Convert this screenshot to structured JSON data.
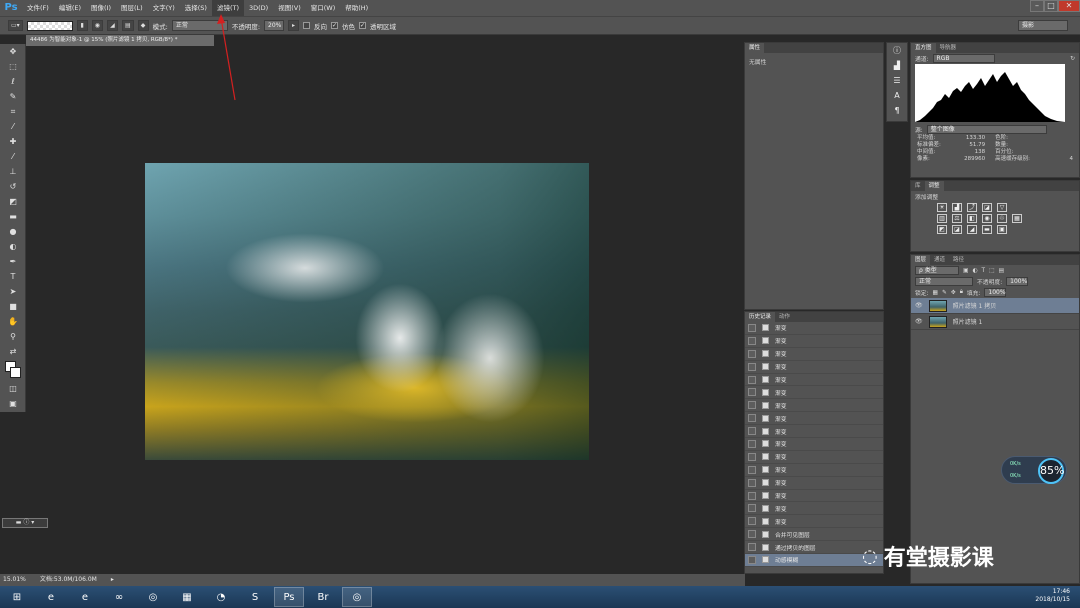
{
  "app": {
    "logo": "Ps"
  },
  "menubar": {
    "items": [
      "文件(F)",
      "编辑(E)",
      "图像(I)",
      "图层(L)",
      "文字(Y)",
      "选择(S)",
      "滤镜(T)",
      "3D(D)",
      "视图(V)",
      "窗口(W)",
      "帮助(H)"
    ],
    "active_index": 6
  },
  "options": {
    "mode_label": "模式:",
    "mode_value": "正常",
    "opacity_label": "不透明度:",
    "opacity_value": "20%",
    "reverse_label": "反向",
    "dither_label": "仿色",
    "transparency_label": "透明区域",
    "workspace": "摄影"
  },
  "document": {
    "tab_title": "44486 为智能对象-1 @ 15% (照片滤镜 1 拷贝, RGB/8*) *"
  },
  "status": {
    "zoom": "15.01%",
    "doc_size": "文档:53.0M/106.0M"
  },
  "properties": {
    "tab": "属性",
    "empty_text": "无属性"
  },
  "history": {
    "tabs": [
      "历史记录",
      "动作"
    ],
    "items": [
      "渐变",
      "渐变",
      "渐变",
      "渐变",
      "渐变",
      "渐变",
      "渐变",
      "渐变",
      "渐变",
      "渐变",
      "渐变",
      "渐变",
      "渐变",
      "渐变",
      "渐变",
      "渐变",
      "合并可见图层",
      "通过拷贝的图层",
      "动感模糊"
    ],
    "active_index": 18
  },
  "histogram": {
    "tabs": [
      "直方图",
      "导航器"
    ],
    "channel_label": "通道:",
    "channel_value": "RGB",
    "source_label": "源:",
    "source_value": "整个图像",
    "stats_left": [
      {
        "label": "平均值:",
        "value": "133.30"
      },
      {
        "label": "标准偏差:",
        "value": "51.79"
      },
      {
        "label": "中间值:",
        "value": "138"
      },
      {
        "label": "像素:",
        "value": "289960"
      }
    ],
    "stats_right": [
      {
        "label": "色阶:",
        "value": ""
      },
      {
        "label": "数量:",
        "value": ""
      },
      {
        "label": "百分位:",
        "value": ""
      },
      {
        "label": "高速缓存级别:",
        "value": "4"
      }
    ]
  },
  "adjustments": {
    "tabs": [
      "库",
      "调整"
    ],
    "add_label": "添加调整"
  },
  "layers": {
    "tabs": [
      "图层",
      "通道",
      "路径"
    ],
    "filter_label": "ρ 类型",
    "blend_mode": "正常",
    "opacity_label": "不透明度:",
    "opacity_value": "100%",
    "lock_label": "锁定:",
    "fill_label": "填充:",
    "fill_value": "100%",
    "items": [
      {
        "name": "照片滤镜 1 拷贝",
        "active": true
      },
      {
        "name": "照片滤镜 1",
        "active": false
      }
    ]
  },
  "netmon": {
    "percent": "85%",
    "up": "0K/s",
    "down": "0K/s"
  },
  "watermark": "有堂摄影课",
  "tray": {
    "time": "17:46",
    "date": "2018/10/15"
  },
  "colors": {
    "accent": "#3fa9f5",
    "selection": "#6e7e94",
    "arrow": "#d42020"
  }
}
